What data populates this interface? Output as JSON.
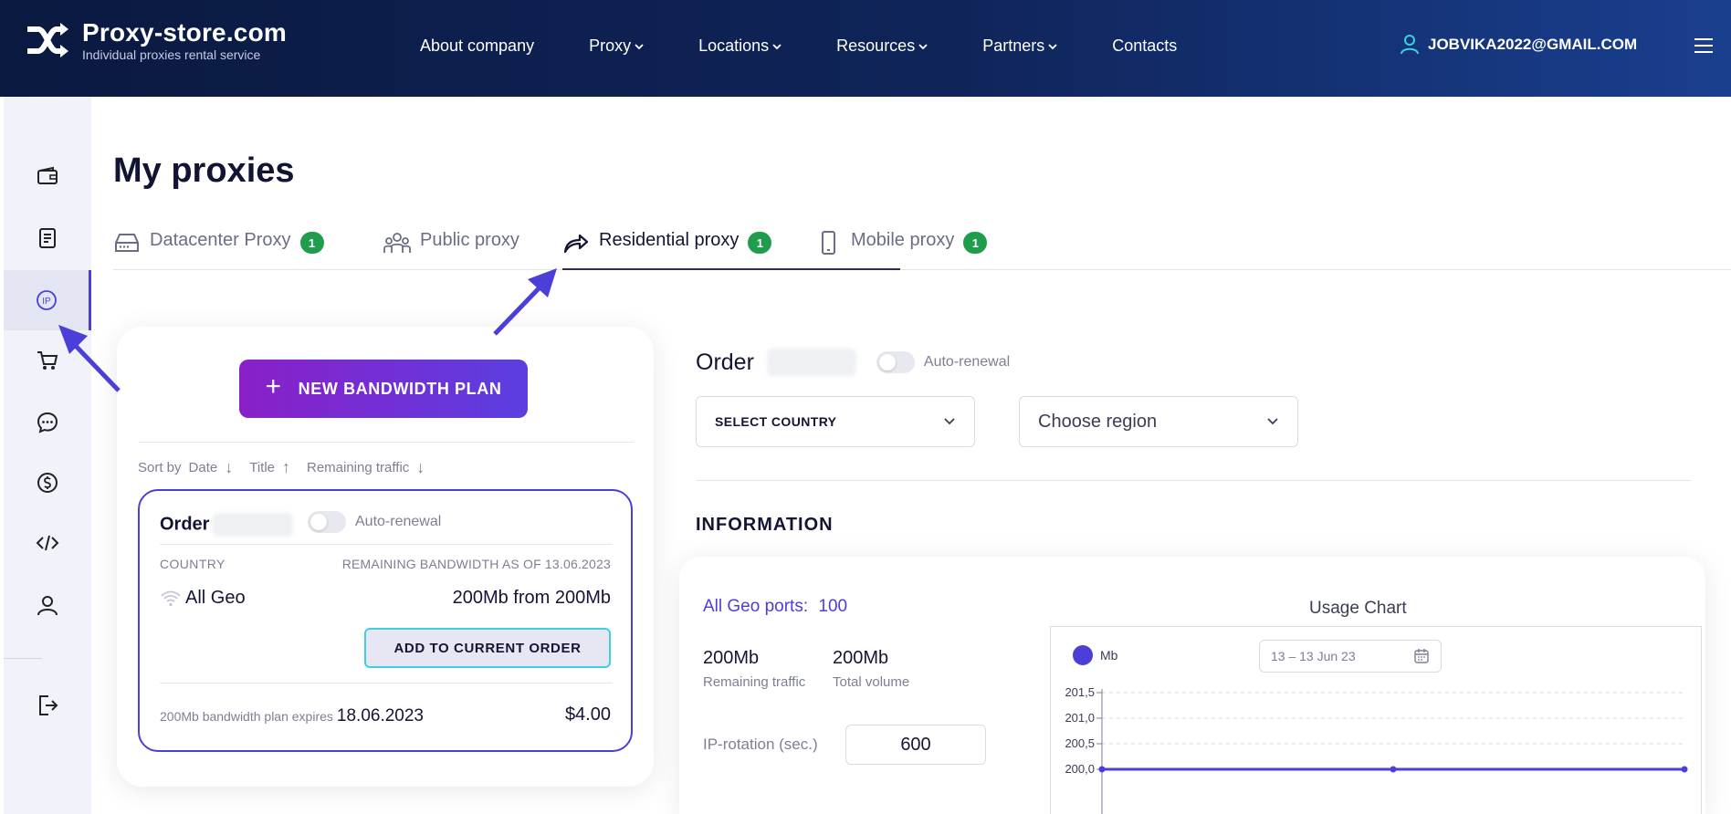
{
  "header": {
    "brand": "Proxy-store.com",
    "tagline": "Individual proxies rental service",
    "nav": [
      {
        "label": "About company",
        "dropdown": false
      },
      {
        "label": "Proxy",
        "dropdown": true
      },
      {
        "label": "Locations",
        "dropdown": true
      },
      {
        "label": "Resources",
        "dropdown": true
      },
      {
        "label": "Partners",
        "dropdown": true
      },
      {
        "label": "Contacts",
        "dropdown": false
      }
    ],
    "user_email": "JOBVIKA2022@GMAIL.COM",
    "colors": {
      "bg_start": "#0a1940",
      "bg_end": "#1a3f8f",
      "user_icon": "#3fd0e0"
    }
  },
  "sidebar": {
    "items": [
      {
        "icon": "wallet-icon",
        "active": false
      },
      {
        "icon": "document-icon",
        "active": false
      },
      {
        "icon": "ip-icon",
        "active": true,
        "label": "IP"
      },
      {
        "icon": "cart-icon",
        "active": false
      },
      {
        "icon": "chat-icon",
        "active": false
      },
      {
        "icon": "dollar-icon",
        "active": false
      },
      {
        "icon": "code-icon",
        "active": false
      },
      {
        "icon": "user-icon",
        "active": false
      },
      {
        "icon": "logout-icon",
        "active": false
      }
    ],
    "accent": "#4c3fd9"
  },
  "page": {
    "title": "My proxies"
  },
  "tabs": [
    {
      "label": "Datacenter Proxy",
      "badge": "1",
      "icon": "server-icon",
      "active": false
    },
    {
      "label": "Public proxy",
      "badge": "",
      "icon": "group-icon",
      "active": false
    },
    {
      "label": "Residential proxy",
      "badge": "1",
      "icon": "share-arrow-icon",
      "active": true
    },
    {
      "label": "Mobile proxy",
      "badge": "1",
      "icon": "phone-icon",
      "active": false
    }
  ],
  "plans": {
    "new_button": "NEW BANDWIDTH PLAN",
    "sort": {
      "label": "Sort by",
      "options": [
        "Date",
        "Title",
        "Remaining traffic"
      ],
      "arrows": [
        "↓",
        "↑",
        "↓"
      ]
    },
    "order": {
      "title": "Order",
      "auto_renewal": "Auto-renewal",
      "country_header": "COUNTRY",
      "remaining_header": "REMAINING BANDWIDTH AS OF 13.06.2023",
      "country": "All Geo",
      "bandwidth": "200Mb from 200Mb",
      "add_button": "ADD TO CURRENT ORDER",
      "expires_label": "200Mb bandwidth plan expires",
      "expires_date": "18.06.2023",
      "price": "$4.00"
    }
  },
  "details": {
    "order_title": "Order",
    "auto_renewal": "Auto-renewal",
    "country_select": "SELECT COUNTRY",
    "region_select": "Choose region",
    "info_title": "INFORMATION",
    "ports_label": "All Geo ports:",
    "ports_value": "100",
    "remaining_value": "200Mb",
    "remaining_label": "Remaining traffic",
    "total_value": "200Mb",
    "total_label": "Total volume",
    "rotation_label": "IP-rotation (sec.)",
    "rotation_value": "600"
  },
  "chart_data": {
    "type": "line",
    "title": "Usage Chart",
    "date_range": "13 – 13 Jun 23",
    "series": [
      {
        "name": "Mb",
        "color": "#4c3fd9",
        "values": [
          200.0,
          200.0,
          200.0
        ]
      }
    ],
    "y_ticks": [
      "201,5",
      "201,0",
      "200,5",
      "200,0"
    ],
    "ylim": [
      200.0,
      201.5
    ],
    "grid": true,
    "legend": "top-left"
  }
}
